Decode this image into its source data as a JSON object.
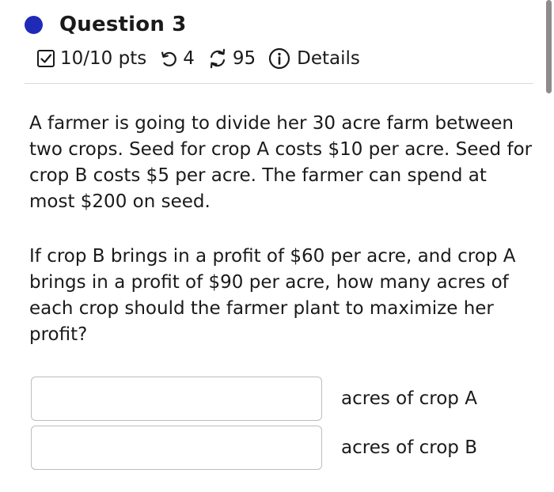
{
  "question": {
    "title": "Question 3",
    "status_color": "#1f2bb8",
    "score": "10/10 pts",
    "retries": "4",
    "attempts": "95",
    "details": "Details",
    "icons": [
      "check-square-icon",
      "retry-icon",
      "sync-icon",
      "info-icon"
    ]
  },
  "problem": {
    "paragraph1": "A farmer is going to divide her 30 acre farm between two crops. Seed for crop A costs $10 per acre. Seed for crop B costs $5 per acre. The farmer can spend at most $200 on seed.",
    "paragraph2": "If crop B brings in a profit of $60 per acre, and crop A brings in a profit of $90 per acre, how many acres of each crop should the farmer plant to maximize her profit?"
  },
  "answers": {
    "crop_a": {
      "value": "",
      "label": "acres of crop A"
    },
    "crop_b": {
      "value": "",
      "label": "acres of crop B"
    }
  }
}
